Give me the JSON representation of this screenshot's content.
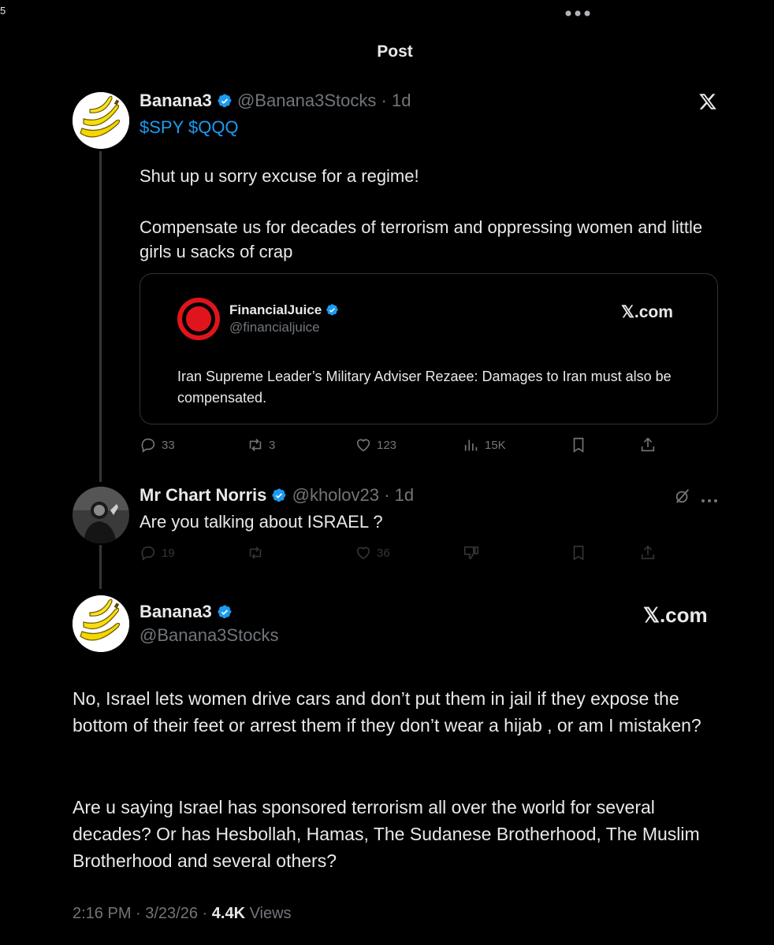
{
  "status_bar": {
    "left_glyph": "5"
  },
  "header": {
    "title": "Post",
    "more_icon": "more-dots-icon"
  },
  "tweet1": {
    "name": "Banana3",
    "handle": "@Banana3Stocks",
    "time": "· 1d",
    "tickers": "$SPY $QQQ",
    "text1": "Shut up u sorry excuse for a regime!",
    "text2": "Compensate us for decades of terrorism and oppressing women and little girls u sacks of crap",
    "x_logo": "x-logo-icon",
    "quote": {
      "name": "FinancialJuice",
      "handle": "@financialjuice",
      "brand": "𝕏.com",
      "text": "Iran Supreme Leader’s Military Adviser Rezaee: Damages to Iran must also be compensated."
    },
    "actions": {
      "replies": "33",
      "reposts": "3",
      "likes": "123",
      "views": "15K"
    }
  },
  "reply": {
    "name": "Mr Chart Norris",
    "handle": "@kholov23",
    "time": "· 1d",
    "text": "Are you talking about ISRAEL ?",
    "actions": {
      "replies": "19",
      "likes": "36"
    }
  },
  "main": {
    "name": "Banana3",
    "handle": "@Banana3Stocks",
    "brand": "𝕏.com",
    "text1": "No, Israel lets women drive cars and don’t put them in jail if they expose the bottom of their feet or arrest them if they don’t wear a hijab , or am I mistaken?",
    "text2": "Are u saying Israel has sponsored terrorism all over the world for several decades? Or has Hesbollah, Hamas, The Sudanese Brotherhood, The Muslim Brotherhood and several others?",
    "time": "2:16 PM · 3/23/26 · ",
    "views_count": "4.4K",
    "views_label": " Views"
  },
  "colors": {
    "accent": "#1d9bf0",
    "muted": "#71767b",
    "background": "#000000",
    "text": "#e7e9ea",
    "quote_logo_red": "#e0141c"
  }
}
